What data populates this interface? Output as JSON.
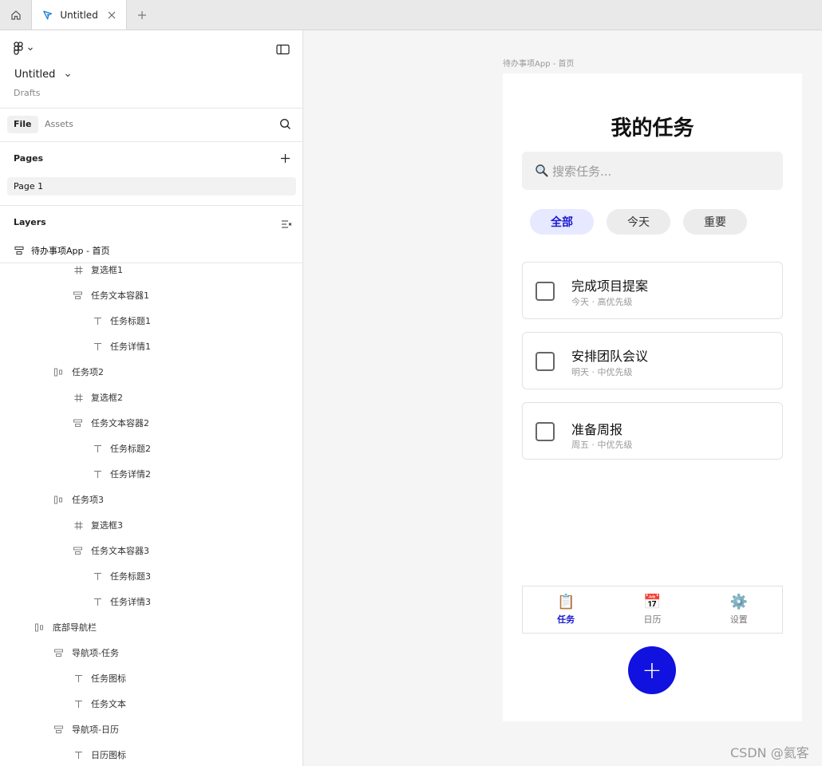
{
  "tabbar": {
    "file_tab_title": "Untitled"
  },
  "left_panel": {
    "file_title": "Untitled",
    "file_subtitle": "Drafts",
    "tabs": {
      "file": "File",
      "assets": "Assets"
    },
    "pages_label": "Pages",
    "pages": [
      "Page 1"
    ],
    "layers_label": "Layers",
    "root_layer": "待办事项App - 首页",
    "layers": [
      {
        "name": "复选框1",
        "indent": 3,
        "icon": "frame"
      },
      {
        "name": "任务文本容器1",
        "indent": 3,
        "icon": "autolayout-v"
      },
      {
        "name": "任务标题1",
        "indent": 4,
        "icon": "text"
      },
      {
        "name": "任务详情1",
        "indent": 4,
        "icon": "text"
      },
      {
        "name": "任务项2",
        "indent": 2,
        "icon": "autolayout-h"
      },
      {
        "name": "复选框2",
        "indent": 3,
        "icon": "frame"
      },
      {
        "name": "任务文本容器2",
        "indent": 3,
        "icon": "autolayout-v"
      },
      {
        "name": "任务标题2",
        "indent": 4,
        "icon": "text"
      },
      {
        "name": "任务详情2",
        "indent": 4,
        "icon": "text"
      },
      {
        "name": "任务项3",
        "indent": 2,
        "icon": "autolayout-h"
      },
      {
        "name": "复选框3",
        "indent": 3,
        "icon": "frame"
      },
      {
        "name": "任务文本容器3",
        "indent": 3,
        "icon": "autolayout-v"
      },
      {
        "name": "任务标题3",
        "indent": 4,
        "icon": "text"
      },
      {
        "name": "任务详情3",
        "indent": 4,
        "icon": "text"
      },
      {
        "name": "底部导航栏",
        "indent": 1,
        "icon": "autolayout-h"
      },
      {
        "name": "导航项-任务",
        "indent": 2,
        "icon": "autolayout-v"
      },
      {
        "name": "任务图标",
        "indent": 3,
        "icon": "text"
      },
      {
        "name": "任务文本",
        "indent": 3,
        "icon": "text"
      },
      {
        "name": "导航项-日历",
        "indent": 2,
        "icon": "autolayout-v"
      },
      {
        "name": "日历图标",
        "indent": 3,
        "icon": "text"
      }
    ]
  },
  "canvas": {
    "frame_label": "待办事项App - 首页",
    "app": {
      "title": "我的任务",
      "search_placeholder": "搜索任务...",
      "filters": [
        {
          "label": "全部",
          "active": true
        },
        {
          "label": "今天",
          "active": false
        },
        {
          "label": "重要",
          "active": false
        }
      ],
      "tasks": [
        {
          "title": "完成项目提案",
          "detail": "今天 · 高优先级"
        },
        {
          "title": "安排团队会议",
          "detail": "明天 · 中优先级"
        },
        {
          "title": "准备周报",
          "detail": "周五 · 中优先级"
        }
      ],
      "nav": [
        {
          "icon": "📋",
          "icon_name": "clipboard-icon",
          "label": "任务",
          "active": true
        },
        {
          "icon": "📅",
          "icon_name": "calendar-icon",
          "label": "日历",
          "active": false
        },
        {
          "icon": "⚙️",
          "icon_name": "gear-icon",
          "label": "设置",
          "active": false
        }
      ],
      "fab_label": "+"
    }
  },
  "watermark_csdn": "CSDN @氦客",
  "colors": {
    "accent": "#1111e0",
    "active_chip_bg": "#e6e9ff"
  }
}
